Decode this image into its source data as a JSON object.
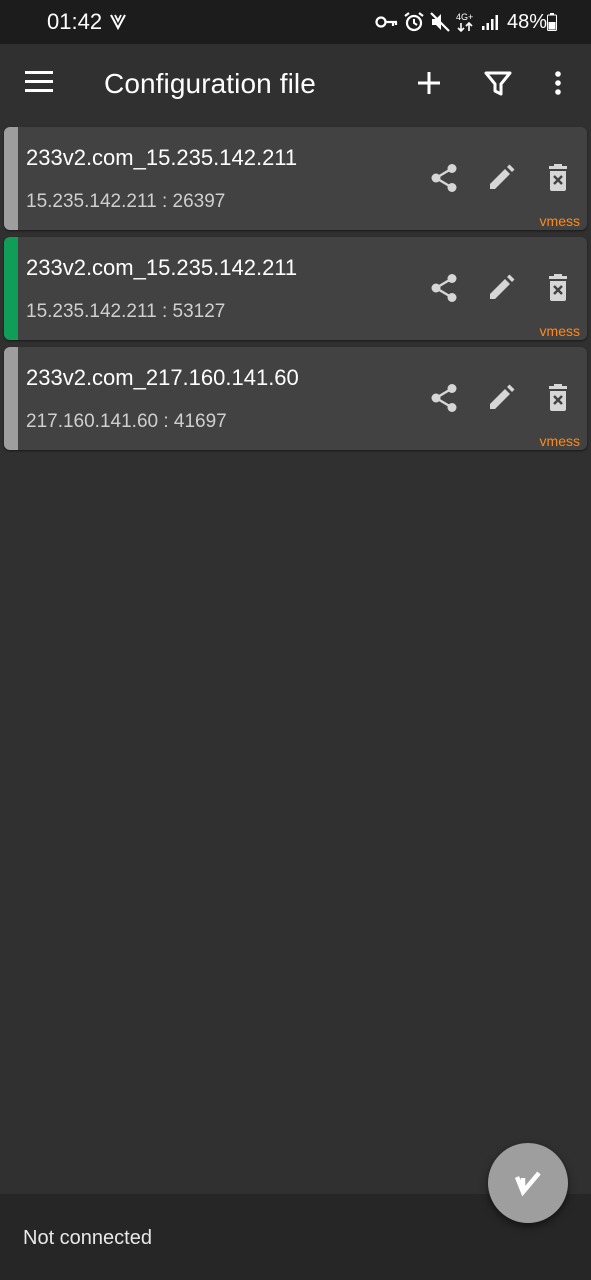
{
  "status_bar": {
    "time": "01:42",
    "battery": "48%",
    "left_icon": "signal-tower-icon",
    "right_icons": [
      "vpn-key-icon",
      "alarm-icon",
      "mute-icon",
      "4g-plus-icon",
      "cell-signal-icon",
      "battery-icon"
    ],
    "network_label": "4G+"
  },
  "toolbar": {
    "title": "Configuration file",
    "menu_icon": "hamburger-menu-icon",
    "add_icon": "plus-icon",
    "filter_icon": "filter-icon",
    "more_icon": "more-vertical-icon"
  },
  "servers": [
    {
      "name": "233v2.com_15.235.142.211",
      "address": "15.235.142.211 : 26397",
      "type": "vmess",
      "selected": false
    },
    {
      "name": "233v2.com_15.235.142.211",
      "address": "15.235.142.211 : 53127",
      "type": "vmess",
      "selected": true
    },
    {
      "name": "233v2.com_217.160.141.60",
      "address": "217.160.141.60 : 41697",
      "type": "vmess",
      "selected": false
    }
  ],
  "colors": {
    "selected_indicator": "#0f9d58",
    "unselected_indicator": "#9e9e9e",
    "type_label": "#ff8a1c",
    "card_background": "#424242",
    "app_background": "#303030"
  },
  "fab": {
    "icon": "v-logo-icon"
  },
  "footer": {
    "status_text": "Not connected"
  }
}
